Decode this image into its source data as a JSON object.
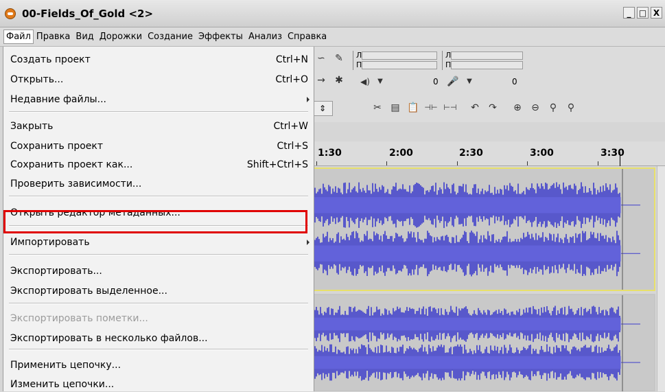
{
  "window": {
    "title": "00-Fields_Of_Gold <2>",
    "buttons": [
      "_",
      "□",
      "X"
    ]
  },
  "menubar": [
    "Файл",
    "Правка",
    "Вид",
    "Дорожки",
    "Создание",
    "Эффекты",
    "Анализ",
    "Справка"
  ],
  "file_menu": {
    "groups": [
      [
        {
          "label": "Создать проект",
          "shortcut": "Ctrl+N"
        },
        {
          "label": "Открыть...",
          "shortcut": "Ctrl+O"
        },
        {
          "label": "Недавние файлы...",
          "submenu": true
        }
      ],
      [
        {
          "label": "Закрыть",
          "shortcut": "Ctrl+W"
        },
        {
          "label": "Сохранить проект",
          "shortcut": "Ctrl+S"
        },
        {
          "label": "Сохранить проект как...",
          "shortcut": "Shift+Ctrl+S"
        },
        {
          "label": "Проверить зависимости..."
        }
      ],
      [
        {
          "label": "Открыть редактор метаданных..."
        }
      ],
      [
        {
          "label": "Импортировать",
          "submenu": true
        }
      ],
      [
        {
          "label": "Экспортировать...",
          "highlighted": true
        },
        {
          "label": "Экспортировать выделенное..."
        }
      ],
      [
        {
          "label": "Экспортировать пометки...",
          "disabled": true
        },
        {
          "label": "Экспортировать в несколько файлов..."
        }
      ],
      [
        {
          "label": "Применить цепочку..."
        },
        {
          "label": "Изменить цепочки..."
        }
      ]
    ]
  },
  "meters": {
    "left": "Л",
    "right": "П",
    "playback_value": "0",
    "record_value": "0"
  },
  "ruler": {
    "labels": [
      "1:30",
      "2:00",
      "2:30",
      "3:00",
      "3:30"
    ]
  },
  "colors": {
    "waveform": "#3c3ccc",
    "waveform_light": "#6a6ae6",
    "highlight": "#e00000",
    "track_selected_border": "#e8e06a"
  },
  "icons": [
    "audacity-app-icon",
    "draw-tool-icon",
    "envelope-tool-icon",
    "multi-tool-icon",
    "time-shift-icon",
    "speaker-icon",
    "microphone-icon",
    "trim-icon",
    "silence-icon",
    "cut-icon",
    "copy-icon",
    "paste-icon",
    "undo-icon",
    "redo-icon",
    "zoom-in-icon",
    "zoom-out-icon",
    "fit-selection-icon",
    "fit-project-icon"
  ]
}
